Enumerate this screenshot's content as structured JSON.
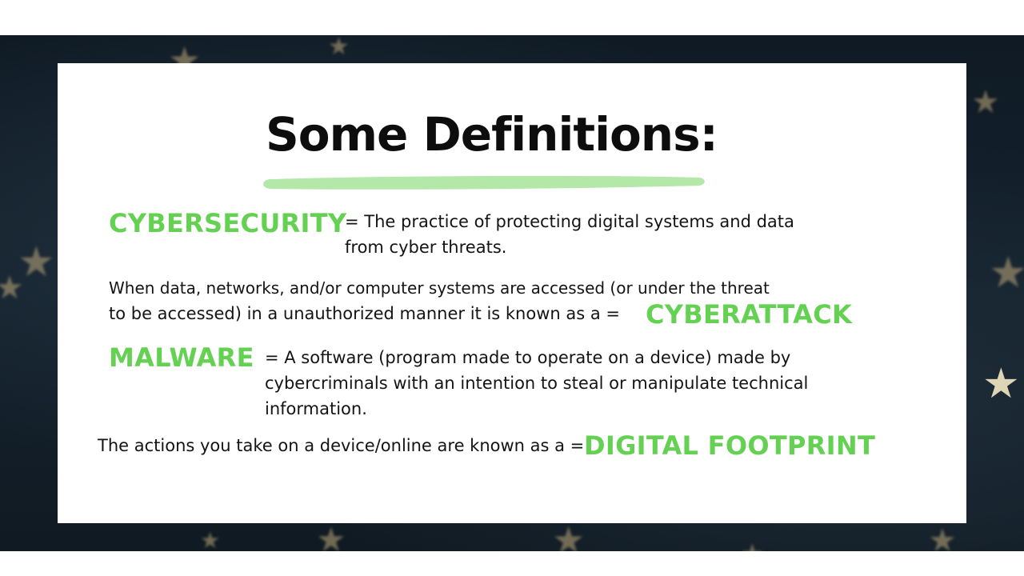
{
  "slide": {
    "title": "Some Definitions:",
    "definitions": {
      "cybersecurity": {
        "term": "CYBERSECURITY",
        "line1": "= The practice of protecting digital systems and data",
        "line2": "from cyber threats."
      },
      "cyberattack": {
        "line1": "When data, networks, and/or computer systems are accessed (or under the threat",
        "line2": "to be accessed) in a unauthorized manner it is known as a =",
        "term": "CYBERATTACK"
      },
      "malware": {
        "term": "MALWARE",
        "line1": "= A software (program made to operate on a device) made by",
        "line2": "cybercriminals with an intention to steal or manipulate technical",
        "line3": "information."
      },
      "digital_footprint": {
        "line1": "The actions you take on a device/online are known as a =",
        "term": "DIGITAL FOOTPRINT"
      }
    }
  },
  "colors": {
    "term_green": "#64d152",
    "underline_green": "#b3e8a9",
    "background_dark": "#101c26",
    "text": "#141414"
  },
  "icons": [
    "star-icon"
  ]
}
